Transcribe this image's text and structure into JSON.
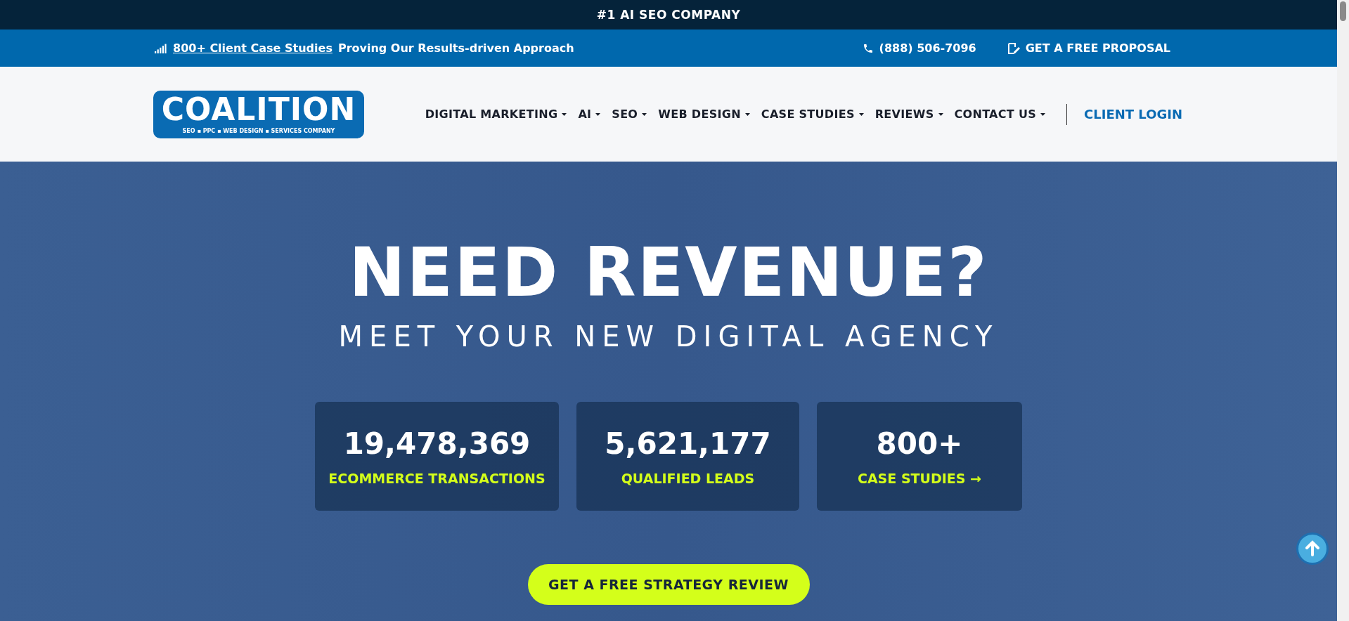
{
  "announcement": "#1 AI SEO COMPANY",
  "info_bar": {
    "link": "800+ Client Case Studies",
    "text": "Proving Our Results-driven Approach",
    "phone": "(888) 506-7096",
    "proposal": "GET A FREE PROPOSAL"
  },
  "logo": {
    "name": "COALITION",
    "tagline": "SEO ▪ PPC ▪ WEB DESIGN ▪ SERVICES COMPANY"
  },
  "nav": [
    {
      "label": "DIGITAL MARKETING",
      "dropdown": true
    },
    {
      "label": "AI",
      "dropdown": true
    },
    {
      "label": "SEO",
      "dropdown": true
    },
    {
      "label": "WEB DESIGN",
      "dropdown": true
    },
    {
      "label": "CASE STUDIES",
      "dropdown": true
    },
    {
      "label": "REVIEWS",
      "dropdown": true
    },
    {
      "label": "CONTACT US",
      "dropdown": true
    }
  ],
  "client_login": "CLIENT LOGIN",
  "hero": {
    "title": "NEED REVENUE?",
    "subtitle": "MEET YOUR NEW DIGITAL AGENCY",
    "stats": [
      {
        "value": "19,478,369",
        "label": "ECOMMERCE TRANSACTIONS"
      },
      {
        "value": "5,621,177",
        "label": "QUALIFIED LEADS"
      },
      {
        "value": "800+",
        "label": "CASE STUDIES →"
      }
    ],
    "cta": "GET A FREE STRATEGY REVIEW"
  }
}
